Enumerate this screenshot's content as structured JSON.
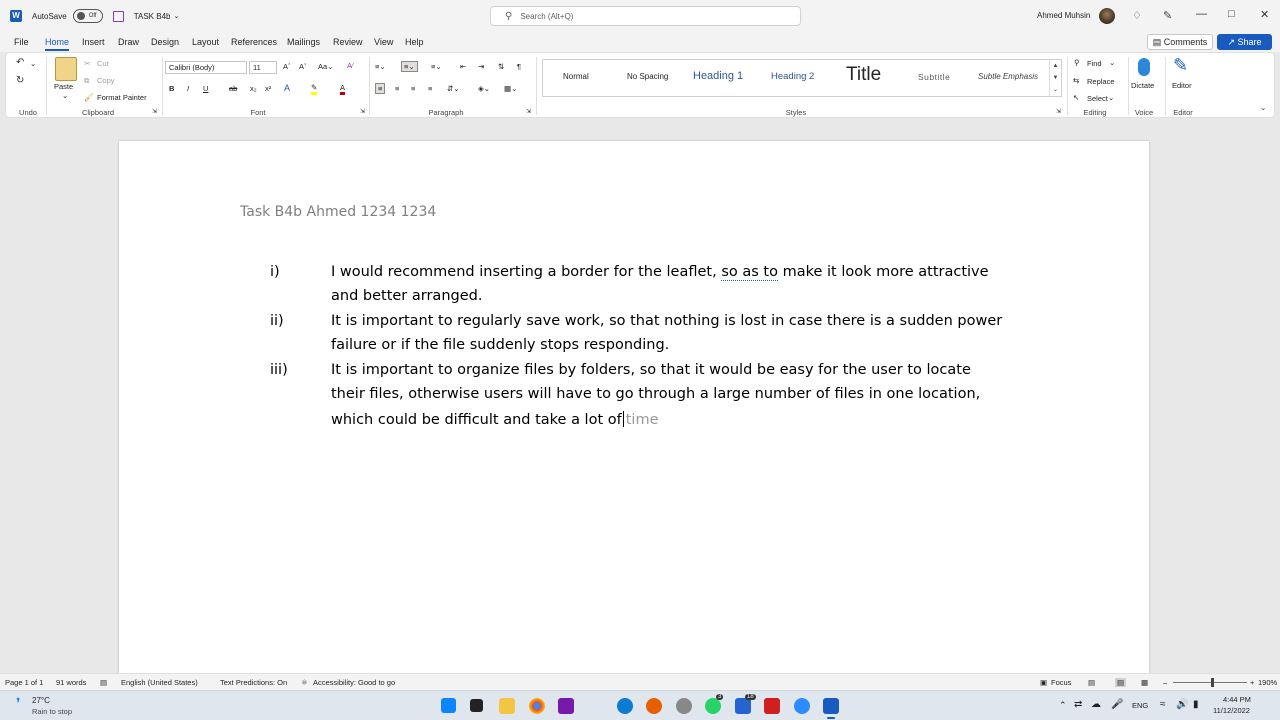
{
  "titlebar": {
    "autosave_label": "AutoSave",
    "autosave_state": "Off",
    "doc_name": "TASK B4b",
    "search_placeholder": "Search (Alt+Q)",
    "user_name": "Ahmed Muhsin"
  },
  "menu": {
    "tabs": [
      "File",
      "Home",
      "Insert",
      "Draw",
      "Design",
      "Layout",
      "References",
      "Mailings",
      "Review",
      "View",
      "Help"
    ],
    "active": "Home",
    "comments_label": "Comments",
    "share_label": "Share"
  },
  "ribbon": {
    "groups": [
      "Undo",
      "Clipboard",
      "Font",
      "Paragraph",
      "Styles",
      "Editing",
      "Voice",
      "Editor"
    ],
    "clipboard": {
      "paste": "Paste",
      "cut": "Cut",
      "copy": "Copy",
      "format_painter": "Format Painter"
    },
    "font": {
      "name": "Calibri (Body)",
      "size": "11"
    },
    "styles": [
      "Normal",
      "No Spacing",
      "Heading 1",
      "Heading 2",
      "Title",
      "Subtitle",
      "Subtle Emphasis"
    ],
    "editing": {
      "find": "Find",
      "replace": "Replace",
      "select": "Select"
    },
    "voice": {
      "dictate": "Dictate"
    },
    "editor": {
      "label": "Editor"
    }
  },
  "document": {
    "title": "Task B4b Ahmed 1234 1234",
    "items": [
      {
        "num": "i)",
        "lines": [
          "I would recommend inserting a border for the leaflet, ",
          "so as to",
          " make it look more attractive",
          "and better arranged."
        ]
      },
      {
        "num": "ii)",
        "lines": [
          "It is important to regularly save work, so that nothing is lost in case there is a sudden power",
          "failure or if the file suddenly stops responding."
        ]
      },
      {
        "num": "iii)",
        "lines": [
          "It is important to organize files by folders, so that it would be easy for the user to locate",
          "their files, otherwise users will have to go through a large number of files in one location,",
          "which could be difficult and take a lot of",
          "time"
        ]
      }
    ]
  },
  "status": {
    "page": "Page 1 of 1",
    "words": "91 words",
    "language": "English (United States)",
    "predictions": "Text Predictions: On",
    "accessibility": "Accessibility: Good to go",
    "focus": "Focus",
    "zoom": "190%"
  },
  "taskbar": {
    "weather_temp": "27°C",
    "weather_desc": "Rain to stop",
    "lang": "ENG",
    "time": "4:44 PM",
    "date": "11/12/2022",
    "badge_whatsapp": "3",
    "badge_tasks": "18"
  },
  "colors": {
    "accent": "#185abd",
    "title_gray": "#7f7f7f"
  }
}
